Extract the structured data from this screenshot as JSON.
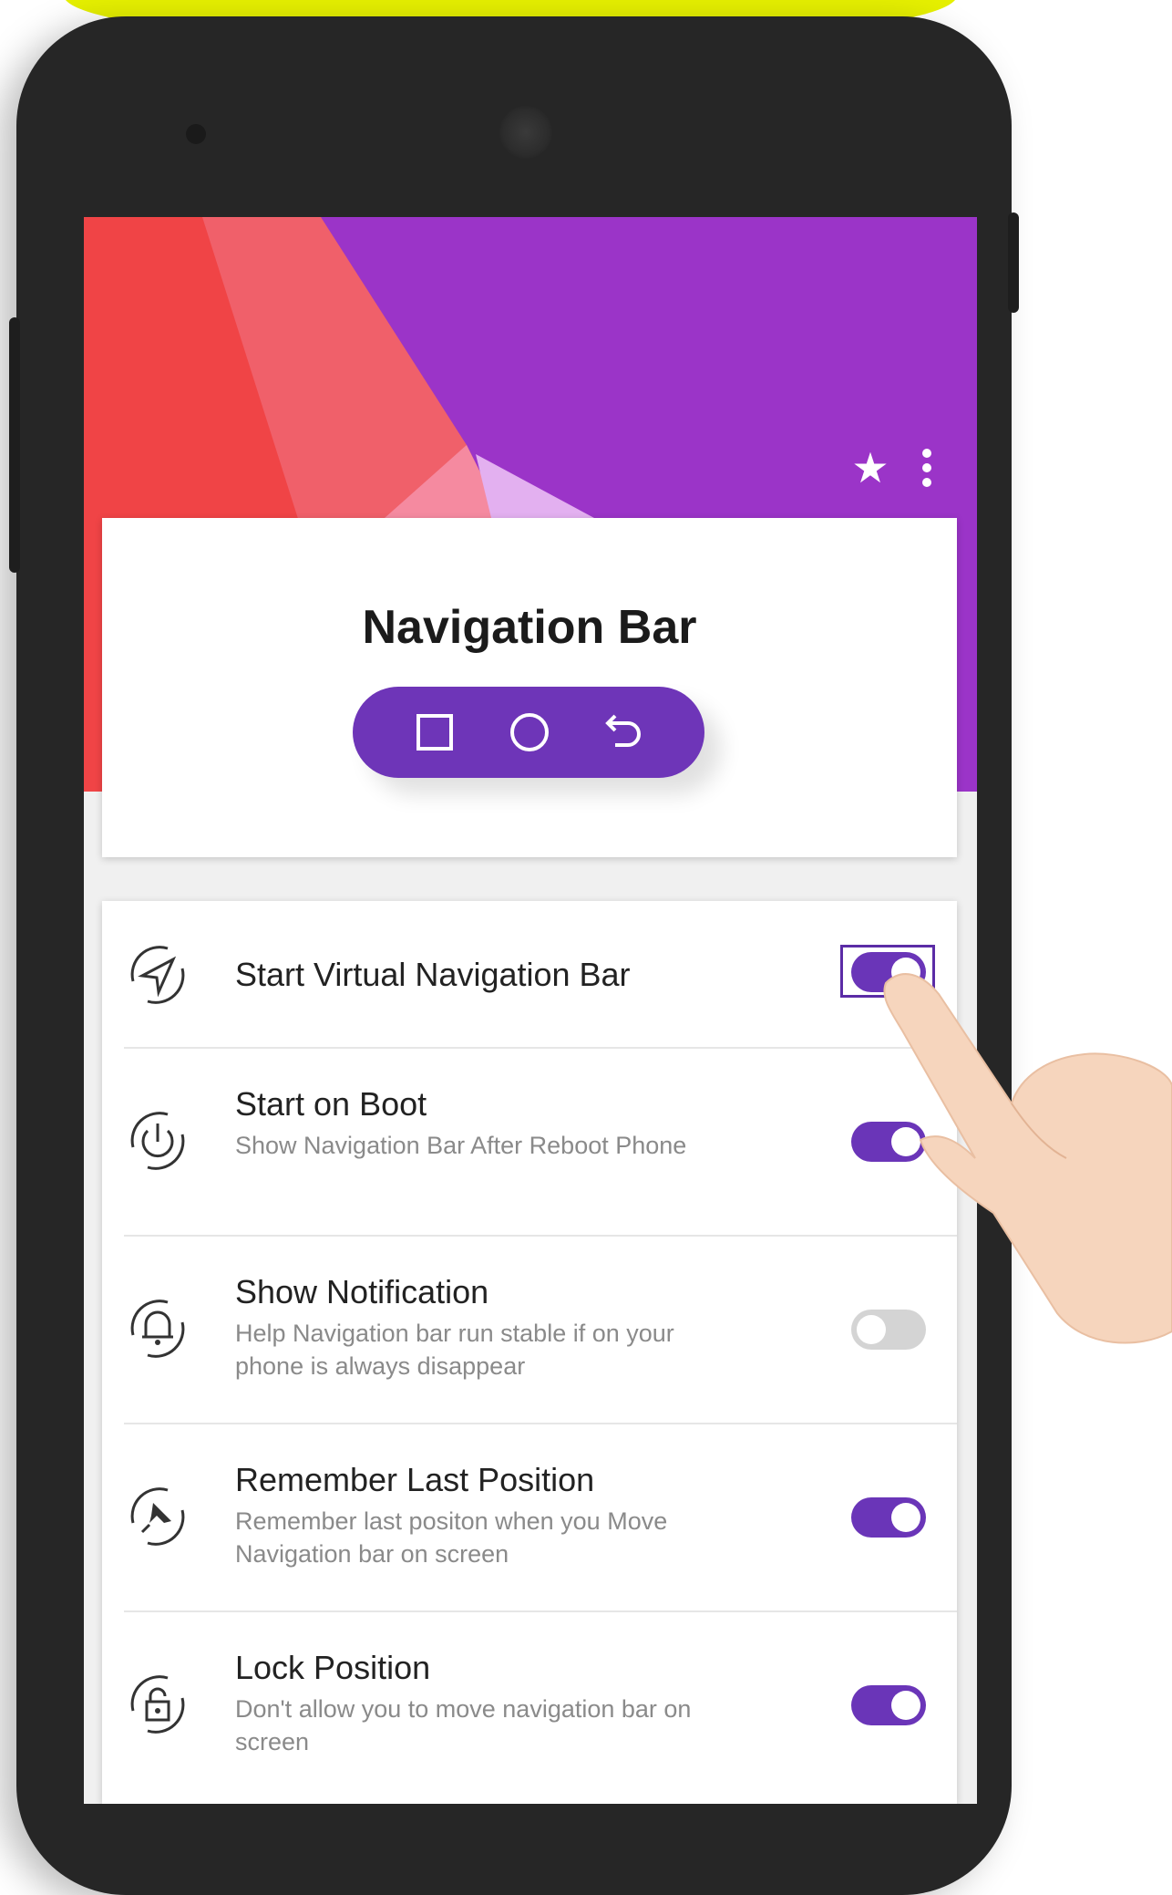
{
  "header": {
    "star_icon": "star-icon",
    "menu_icon": "more-vert-icon"
  },
  "title_card": {
    "title": "Navigation Bar",
    "nav_buttons": [
      "recent-apps-icon",
      "home-icon",
      "back-icon"
    ]
  },
  "settings": [
    {
      "title": "Start Virtual Navigation Bar",
      "subtitle": "",
      "enabled": true,
      "icon": "navigation-arrow-icon"
    },
    {
      "title": "Start on Boot",
      "subtitle": "Show Navigation Bar After Reboot Phone",
      "enabled": true,
      "icon": "power-icon"
    },
    {
      "title": "Show Notification",
      "subtitle": "Help Navigation bar run stable if on your phone is always disappear",
      "enabled": false,
      "icon": "bell-icon"
    },
    {
      "title": "Remember Last Position",
      "subtitle": "Remember last positon when you Move Navigation bar on screen",
      "enabled": true,
      "icon": "pin-icon"
    },
    {
      "title": "Lock Position",
      "subtitle": "Don't allow you to move navigation bar on screen",
      "enabled": true,
      "icon": "lock-icon"
    }
  ],
  "colors": {
    "accent": "#6a35b8",
    "header_purple": "#9b34c8",
    "header_red": "#f0474a",
    "highlight_yellow": "#e6f000"
  }
}
